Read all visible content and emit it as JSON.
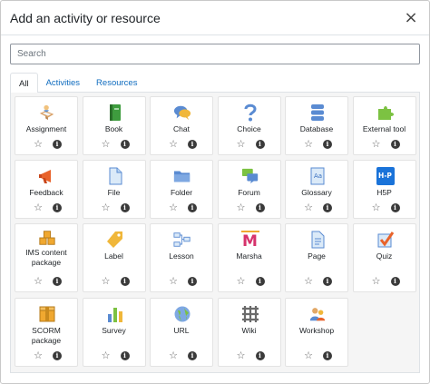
{
  "dialog": {
    "title": "Add an activity or resource",
    "close_glyph": "×"
  },
  "search": {
    "placeholder": "Search",
    "value": ""
  },
  "tabs": [
    {
      "label": "All",
      "active": true
    },
    {
      "label": "Activities",
      "active": false
    },
    {
      "label": "Resources",
      "active": false
    }
  ],
  "tile_actions": {
    "star_glyph": "☆",
    "info_glyph": "i"
  },
  "items": [
    {
      "label": "Assignment",
      "icon": "assignment-icon"
    },
    {
      "label": "Book",
      "icon": "book-icon"
    },
    {
      "label": "Chat",
      "icon": "chat-icon"
    },
    {
      "label": "Choice",
      "icon": "choice-icon"
    },
    {
      "label": "Database",
      "icon": "database-icon"
    },
    {
      "label": "External tool",
      "icon": "external-tool-icon"
    },
    {
      "label": "Feedback",
      "icon": "feedback-icon"
    },
    {
      "label": "File",
      "icon": "file-icon"
    },
    {
      "label": "Folder",
      "icon": "folder-icon"
    },
    {
      "label": "Forum",
      "icon": "forum-icon"
    },
    {
      "label": "Glossary",
      "icon": "glossary-icon"
    },
    {
      "label": "H5P",
      "icon": "h5p-icon",
      "icon_text": "H-P"
    },
    {
      "label": "IMS content package",
      "icon": "ims-package-icon"
    },
    {
      "label": "Label",
      "icon": "label-icon"
    },
    {
      "label": "Lesson",
      "icon": "lesson-icon"
    },
    {
      "label": "Marsha",
      "icon": "marsha-icon",
      "icon_text": "M"
    },
    {
      "label": "Page",
      "icon": "page-icon"
    },
    {
      "label": "Quiz",
      "icon": "quiz-icon"
    },
    {
      "label": "SCORM package",
      "icon": "scorm-package-icon"
    },
    {
      "label": "Survey",
      "icon": "survey-icon"
    },
    {
      "label": "URL",
      "icon": "url-icon"
    },
    {
      "label": "Wiki",
      "icon": "wiki-icon"
    },
    {
      "label": "Workshop",
      "icon": "workshop-icon"
    }
  ]
}
